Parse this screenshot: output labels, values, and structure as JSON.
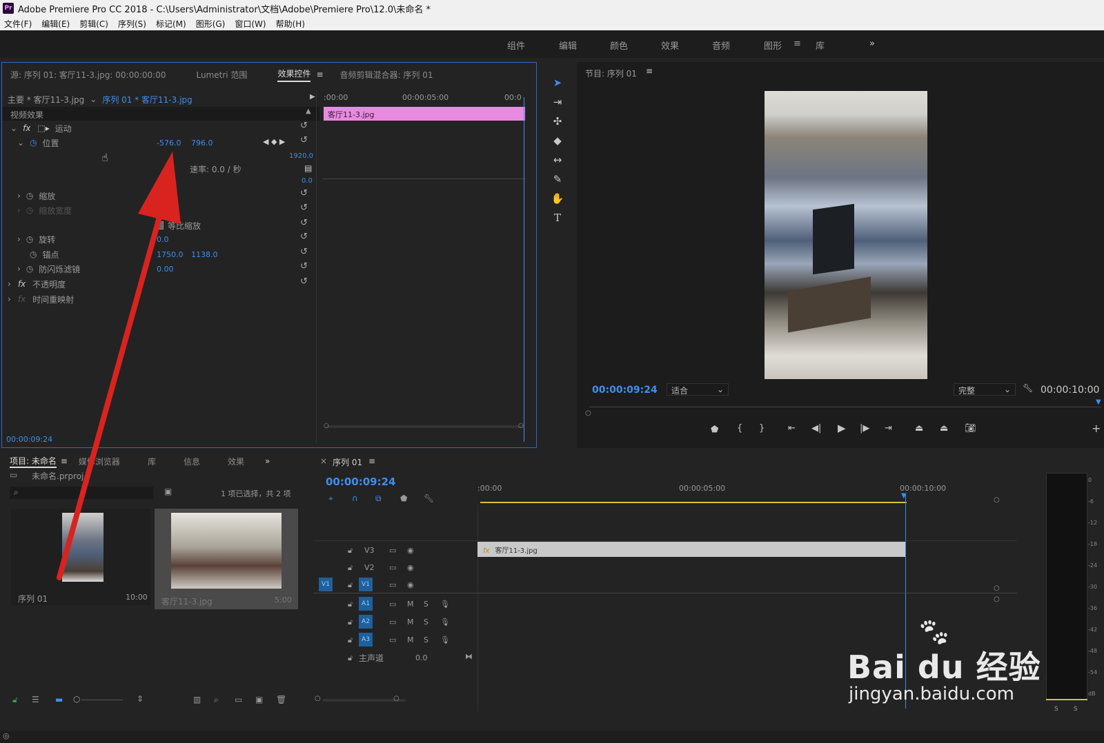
{
  "window": {
    "title": "Adobe Premiere Pro CC 2018 - C:\\Users\\Administrator\\文档\\Adobe\\Premiere Pro\\12.0\\未命名 *",
    "logo": "Pr"
  },
  "menu": [
    "文件(F)",
    "编辑(E)",
    "剪辑(C)",
    "序列(S)",
    "标记(M)",
    "图形(G)",
    "窗口(W)",
    "帮助(H)"
  ],
  "workspaces": [
    "组件",
    "编辑",
    "颜色",
    "效果",
    "音频",
    "图形",
    "库"
  ],
  "workspace_more": "»",
  "source_panel": {
    "tabs": [
      "源: 序列 01: 客厅11-3.jpg: 00:00:00:00",
      "Lumetri 范围",
      "效果控件",
      "音频剪辑混合器: 序列 01"
    ],
    "active_tab": "效果控件",
    "master": "主要 * 客厅11-3.jpg",
    "sequence_link": "序列 01 * 客厅11-3.jpg",
    "mini_ruler": [
      ":00:00",
      "00:00:05:00",
      "00:0"
    ],
    "clip_name": "客厅11-3.jpg",
    "section": "视频效果",
    "motion": "运动",
    "position_label": "位置",
    "position_x": "-576.0",
    "position_y": "796.0",
    "pos_max": "1920.0",
    "pos_min": "0.0",
    "rate": "速率: 0.0 / 秒",
    "scale": "缩放",
    "scale_width": "缩放宽度",
    "uniform": "等比缩放",
    "rotate": "旋转",
    "rotate_v": "0.0",
    "anchor": "锚点",
    "anchor_x": "1750.0",
    "anchor_y": "1138.0",
    "flicker": "防闪烁滤镜",
    "flicker_v": "0.00",
    "opacity": "不透明度",
    "timeremap": "时间重映射",
    "timecode": "00:00:09:24"
  },
  "program": {
    "title": "节目: 序列 01",
    "timecode": "00:00:09:24",
    "fit": "适合",
    "quality": "完整",
    "duration": "00:00:10:00"
  },
  "project": {
    "tabs": [
      "项目: 未命名",
      "媒体浏览器",
      "库",
      "信息",
      "效果"
    ],
    "file": "未命名.prproj",
    "selection": "1 项已选择，共 2 项",
    "items": [
      {
        "name": "序列 01",
        "duration": "10:00"
      },
      {
        "name": "客厅11-3.jpg",
        "duration": "5:00"
      }
    ]
  },
  "timeline": {
    "title": "序列 01",
    "timecode": "00:00:09:24",
    "ruler": [
      ":00:00",
      "00:00:05:00",
      "00:00:10:00"
    ],
    "clip": "客厅11-3.jpg",
    "tracks_v": [
      "V3",
      "V2",
      "V1"
    ],
    "tracks_a": [
      "A1",
      "A2",
      "A3"
    ],
    "master": "主声道",
    "master_v": "0.0",
    "src_v": "V1"
  },
  "meter": [
    "0",
    "-6",
    "-12",
    "-18",
    "-24",
    "-30",
    "-36",
    "-42",
    "-48",
    "-54",
    "dB"
  ],
  "meter_solo": [
    "S",
    "S"
  ],
  "watermark": {
    "brand": "Bai du 经验",
    "url": "jingyan.baidu.com"
  },
  "colors": {
    "accent": "#3d8ff0",
    "clip_pink": "#e88ae0",
    "arrow": "#d9231f",
    "playhead": "#3d8ff0"
  }
}
